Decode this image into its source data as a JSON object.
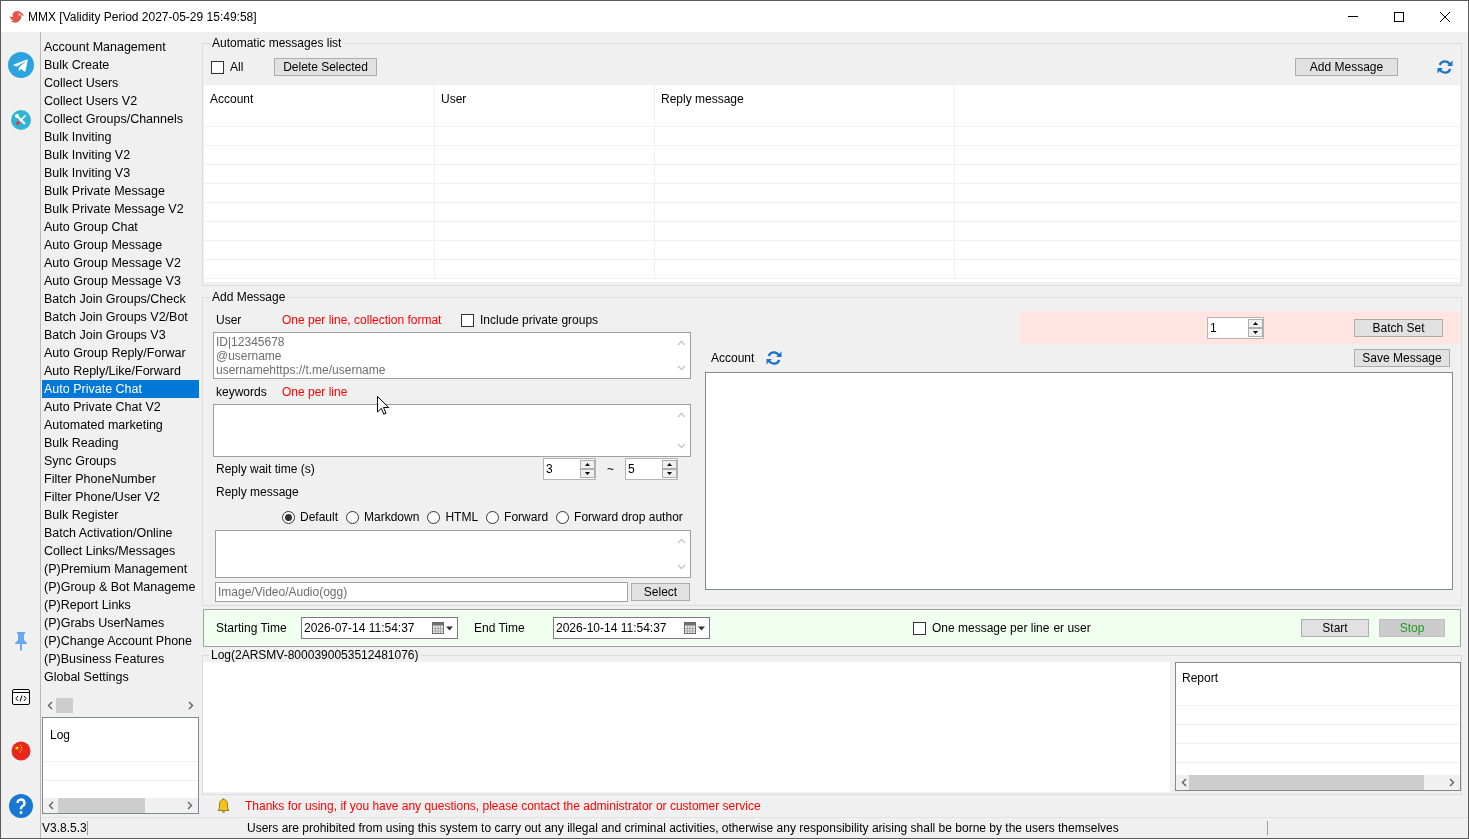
{
  "window": {
    "title": "MMX [Validity Period 2027-05-29 15:49:58]"
  },
  "sidebar": {
    "items": [
      {
        "label": "Account Management",
        "selected": false
      },
      {
        "label": "Bulk Create",
        "selected": false
      },
      {
        "label": "Collect Users",
        "selected": false
      },
      {
        "label": "Collect Users V2",
        "selected": false
      },
      {
        "label": "Collect Groups/Channels",
        "selected": false
      },
      {
        "label": "Bulk Inviting",
        "selected": false
      },
      {
        "label": "Bulk Inviting V2",
        "selected": false
      },
      {
        "label": "Bulk Inviting V3",
        "selected": false
      },
      {
        "label": "Bulk Private Message",
        "selected": false
      },
      {
        "label": "Bulk Private Message V2",
        "selected": false
      },
      {
        "label": "Auto Group Chat",
        "selected": false
      },
      {
        "label": "Auto Group Message",
        "selected": false
      },
      {
        "label": "Auto Group Message V2",
        "selected": false
      },
      {
        "label": "Auto Group Message V3",
        "selected": false
      },
      {
        "label": "Batch Join Groups/Check",
        "selected": false
      },
      {
        "label": "Batch Join Groups V2/Bot",
        "selected": false
      },
      {
        "label": "Batch Join Groups V3",
        "selected": false
      },
      {
        "label": "Auto Group Reply/Forwar",
        "selected": false
      },
      {
        "label": "Auto Reply/Like/Forward",
        "selected": false
      },
      {
        "label": "Auto Private Chat",
        "selected": true
      },
      {
        "label": "Auto Private Chat V2",
        "selected": false
      },
      {
        "label": "Automated marketing",
        "selected": false
      },
      {
        "label": "Bulk Reading",
        "selected": false
      },
      {
        "label": "Sync Groups",
        "selected": false
      },
      {
        "label": "Filter PhoneNumber",
        "selected": false
      },
      {
        "label": "Filter Phone/User V2",
        "selected": false
      },
      {
        "label": "Bulk Register",
        "selected": false
      },
      {
        "label": "Batch Activation/Online",
        "selected": false
      },
      {
        "label": "Collect Links/Messages",
        "selected": false
      },
      {
        "label": "(P)Premium Management",
        "selected": false
      },
      {
        "label": "(P)Group & Bot Manageme",
        "selected": false
      },
      {
        "label": "(P)Report Links",
        "selected": false
      },
      {
        "label": "(P)Grabs UserNames",
        "selected": false
      },
      {
        "label": "(P)Change Account Phone",
        "selected": false
      },
      {
        "label": "(P)Business Features",
        "selected": false
      },
      {
        "label": "Global Settings",
        "selected": false
      }
    ],
    "log_panel": {
      "header": "Log"
    }
  },
  "automatic_messages": {
    "title": "Automatic messages list",
    "select_all": {
      "label": "All",
      "checked": false
    },
    "delete_button": "Delete Selected",
    "add_button": "Add Message",
    "table": {
      "columns": [
        "Account",
        "User",
        "Reply message"
      ]
    }
  },
  "add_message": {
    "title": "Add Message",
    "user": {
      "label": "User",
      "hint": "One per line, collection format",
      "placeholder": "ID|12345678\n@username\nusernamehttps://t.me/username"
    },
    "include_private_groups": {
      "label": "Include private groups",
      "checked": false
    },
    "keywords": {
      "label": "keywords",
      "hint": "One per line"
    },
    "reply_wait_time": {
      "label": "Reply wait time (s)",
      "min": "3",
      "separator": "~",
      "max": "5"
    },
    "reply_message": {
      "label": "Reply message",
      "formats": [
        {
          "label": "Default",
          "selected": true
        },
        {
          "label": "Markdown",
          "selected": false
        },
        {
          "label": "HTML",
          "selected": false
        },
        {
          "label": "Forward",
          "selected": false
        },
        {
          "label": "Forward drop author",
          "selected": false
        }
      ]
    },
    "media": {
      "placeholder": "Image/Video/Audio(ogg)",
      "button": "Select"
    },
    "batch": {
      "value": "1",
      "button": "Batch Set"
    },
    "account": {
      "label": "Account"
    },
    "save_button": "Save Message"
  },
  "schedule": {
    "start": {
      "label": "Starting Time",
      "value": "2026-07-14 11:54:37"
    },
    "end": {
      "label": "End Time",
      "value": "2026-10-14 11:54:37"
    },
    "one_message_per_line": {
      "label": "One message per line",
      "checked": false
    },
    "overlapped_label": "er user",
    "buttons": [
      {
        "label": "Start",
        "disabled": false
      },
      {
        "label": "Stop",
        "disabled": true
      }
    ]
  },
  "log": {
    "title": "Log(2ARSMV-8000390053512481076)",
    "report": {
      "header": "Report"
    }
  },
  "notice": "Thanks for using, if you have any questions, please contact the administrator or customer service",
  "status_bar": {
    "version": "V3.8.5.3",
    "message": "Users are prohibited from using this system to carry out any illegal and criminal activities, otherwise any responsibility arising shall be borne by the users themselves"
  }
}
